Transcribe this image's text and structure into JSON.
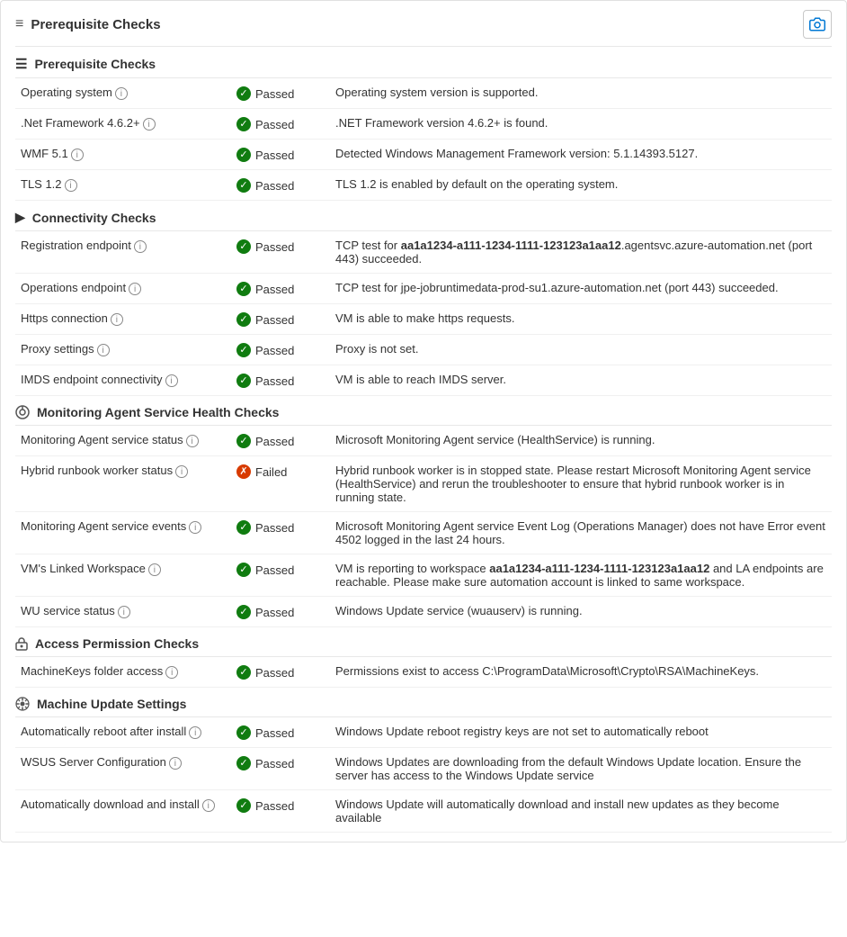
{
  "header": {
    "title": "Prerequisite Checks",
    "camera_label": "camera"
  },
  "sections": [
    {
      "id": "prerequisite",
      "title": "Prerequisite Checks",
      "icon": "≡",
      "rows": [
        {
          "check": "Operating system",
          "has_info": true,
          "status": "Passed",
          "status_type": "passed",
          "description": "Operating system version is supported."
        },
        {
          "check": ".Net Framework 4.6.2+",
          "has_info": true,
          "status": "Passed",
          "status_type": "passed",
          "description": ".NET Framework version 4.6.2+ is found."
        },
        {
          "check": "WMF 5.1",
          "has_info": true,
          "status": "Passed",
          "status_type": "passed",
          "description": "Detected Windows Management Framework version: 5.1.14393.5127."
        },
        {
          "check": "TLS 1.2",
          "has_info": true,
          "status": "Passed",
          "status_type": "passed",
          "description": "TLS 1.2 is enabled by default on the operating system."
        }
      ]
    },
    {
      "id": "connectivity",
      "title": "Connectivity Checks",
      "icon": "🔗",
      "rows": [
        {
          "check": "Registration endpoint",
          "has_info": true,
          "status": "Passed",
          "status_type": "passed",
          "description": "TCP test for aa1a1234-a111-1234-1111-123123a1aa12.agentsvc.azure-automation.net (port 443) succeeded."
        },
        {
          "check": "Operations endpoint",
          "has_info": true,
          "status": "Passed",
          "status_type": "passed",
          "description": "TCP test for jpe-jobruntimedata-prod-su1.azure-automation.net (port 443) succeeded."
        },
        {
          "check": "Https connection",
          "has_info": true,
          "status": "Passed",
          "status_type": "passed",
          "description": "VM is able to make https requests."
        },
        {
          "check": "Proxy settings",
          "has_info": true,
          "status": "Passed",
          "status_type": "passed",
          "description": "Proxy is not set."
        },
        {
          "check": "IMDS endpoint connectivity",
          "has_info": true,
          "status": "Passed",
          "status_type": "passed",
          "description": "VM is able to reach IMDS server."
        }
      ]
    },
    {
      "id": "monitoring",
      "title": "Monitoring Agent Service Health Checks",
      "icon": "⚙",
      "rows": [
        {
          "check": "Monitoring Agent service status",
          "has_info": true,
          "status": "Passed",
          "status_type": "passed",
          "description": "Microsoft Monitoring Agent service (HealthService) is running."
        },
        {
          "check": "Hybrid runbook worker status",
          "has_info": true,
          "status": "Failed",
          "status_type": "failed",
          "description": "Hybrid runbook worker is in stopped state. Please restart Microsoft Monitoring Agent service (HealthService) and rerun the troubleshooter to ensure that hybrid runbook worker is in running state."
        },
        {
          "check": "Monitoring Agent service events",
          "has_info": true,
          "status": "Passed",
          "status_type": "passed",
          "description": "Microsoft Monitoring Agent service Event Log (Operations Manager) does not have Error event 4502 logged in the last 24 hours."
        },
        {
          "check": "VM's Linked Workspace",
          "has_info": true,
          "status": "Passed",
          "status_type": "passed",
          "description": "VM is reporting to workspace aa1a1234-a111-1234-1111-123123a1aa12 and LA endpoints are reachable. Please make sure automation account is linked to same workspace."
        },
        {
          "check": "WU service status",
          "has_info": true,
          "status": "Passed",
          "status_type": "passed",
          "description": "Windows Update service (wuauserv) is running."
        }
      ]
    },
    {
      "id": "access",
      "title": "Access Permission Checks",
      "icon": "🔒",
      "rows": [
        {
          "check": "MachineKeys folder access",
          "has_info": true,
          "status": "Passed",
          "status_type": "passed",
          "description": "Permissions exist to access C:\\ProgramData\\Microsoft\\Crypto\\RSA\\MachineKeys."
        }
      ]
    },
    {
      "id": "machine_update",
      "title": "Machine Update Settings",
      "icon": "⚙",
      "rows": [
        {
          "check": "Automatically reboot after install",
          "has_info": true,
          "status": "Passed",
          "status_type": "passed",
          "description": "Windows Update reboot registry keys are not set to automatically reboot"
        },
        {
          "check": "WSUS Server Configuration",
          "has_info": true,
          "status": "Passed",
          "status_type": "passed",
          "description": "Windows Updates are downloading from the default Windows Update location. Ensure the server has access to the Windows Update service"
        },
        {
          "check": "Automatically download and install",
          "has_info": true,
          "status": "Passed",
          "status_type": "passed",
          "description": "Windows Update will automatically download and install new updates as they become available"
        }
      ]
    }
  ],
  "labels": {
    "passed": "Passed",
    "failed": "Failed",
    "info_symbol": "i",
    "check_symbol": "✓",
    "x_symbol": "✕"
  }
}
